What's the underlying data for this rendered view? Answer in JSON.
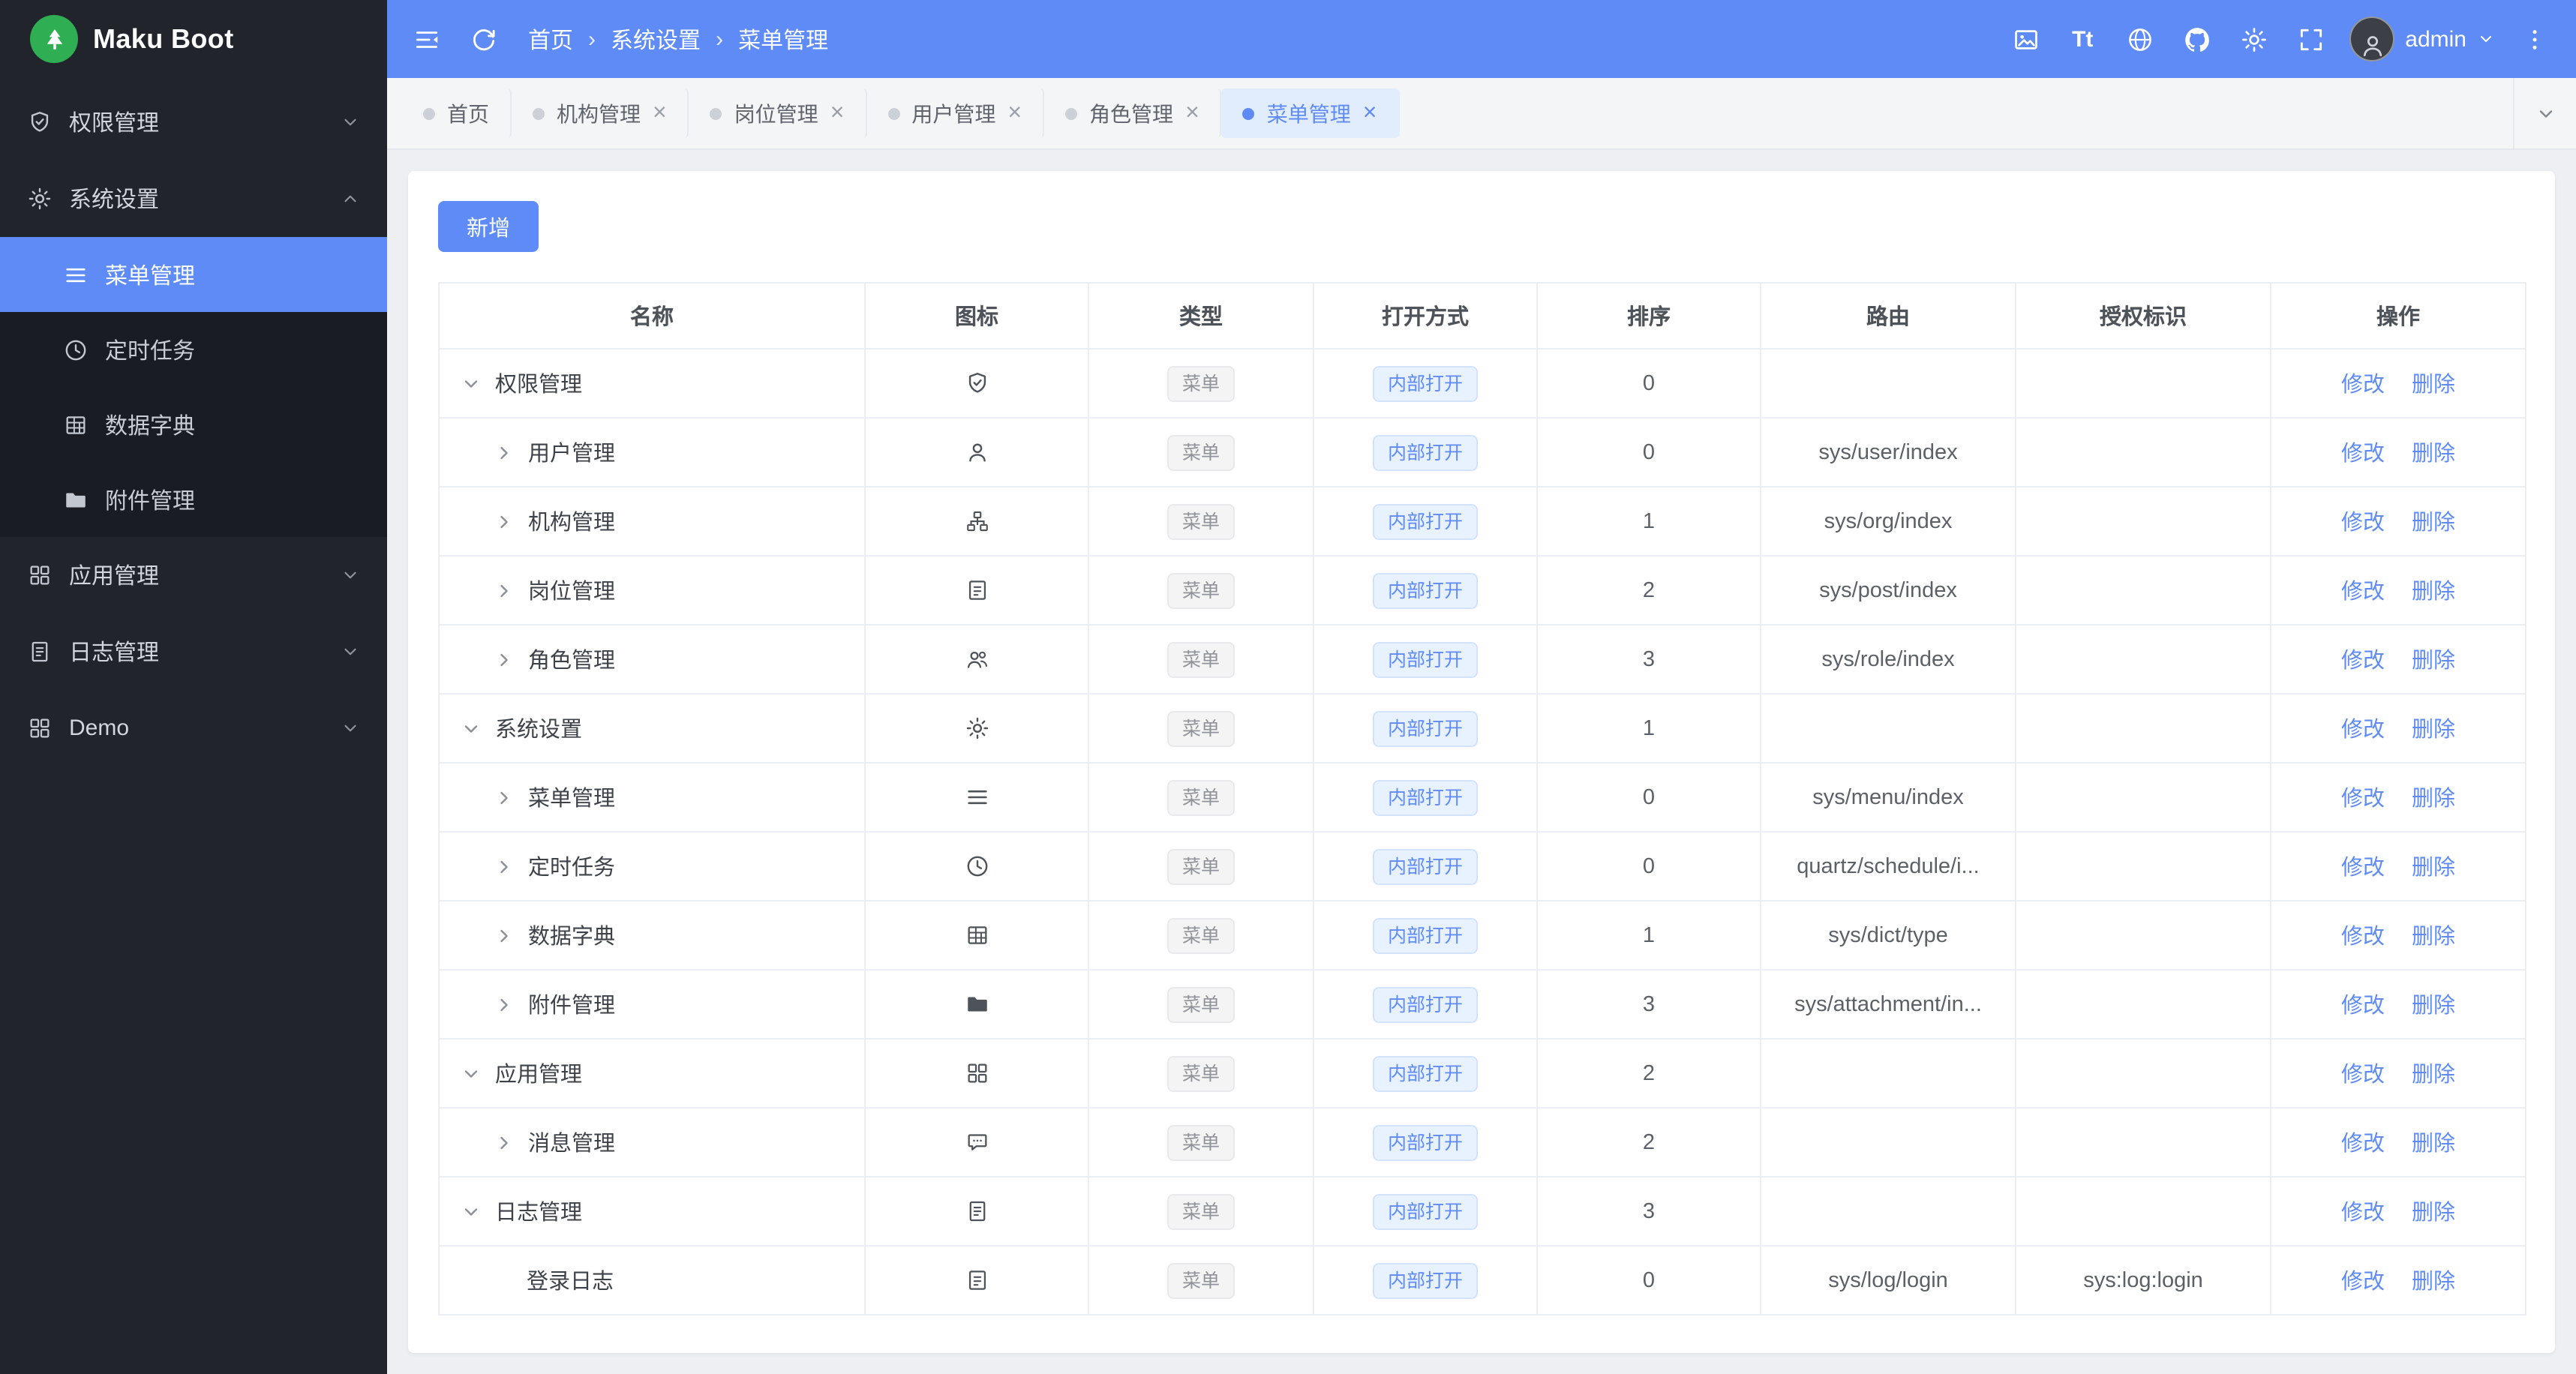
{
  "theme": {
    "primary": "#5e8bf5",
    "sidebar_bg": "#21242b",
    "submenu_bg": "#191c22",
    "logo_green": "#2fae53",
    "tag_gray_text": "#909399",
    "tag_blue_text": "#5e8bf5"
  },
  "logo": {
    "title": "Maku Boot"
  },
  "header": {
    "breadcrumb": [
      "首页",
      "系统设置",
      "菜单管理"
    ],
    "separator": "›",
    "tools": [
      {
        "key": "image",
        "icon": "image"
      },
      {
        "key": "font-size",
        "label": "Tt"
      },
      {
        "key": "language",
        "icon": "globe"
      },
      {
        "key": "github",
        "icon": "github"
      },
      {
        "key": "settings",
        "icon": "gear"
      },
      {
        "key": "fullscreen",
        "icon": "fullscreen"
      }
    ],
    "user": {
      "name": "admin"
    }
  },
  "sidebar": {
    "items": [
      {
        "key": "permission",
        "label": "权限管理",
        "icon": "shield",
        "expanded": false
      },
      {
        "key": "system",
        "label": "系统设置",
        "icon": "gear",
        "expanded": true,
        "children": [
          {
            "key": "menu",
            "label": "菜单管理",
            "icon": "menu",
            "active": true
          },
          {
            "key": "schedule",
            "label": "定时任务",
            "icon": "clock",
            "active": false
          },
          {
            "key": "dict",
            "label": "数据字典",
            "icon": "table",
            "active": false
          },
          {
            "key": "attachment",
            "label": "附件管理",
            "icon": "folder",
            "active": false
          }
        ]
      },
      {
        "key": "apps",
        "label": "应用管理",
        "icon": "grid",
        "expanded": false
      },
      {
        "key": "logs",
        "label": "日志管理",
        "icon": "doc",
        "expanded": false
      },
      {
        "key": "demo",
        "label": "Demo",
        "icon": "grid",
        "expanded": false
      }
    ]
  },
  "tabs": {
    "close_glyph": "×",
    "items": [
      {
        "key": "home",
        "label": "首页",
        "closable": false,
        "active": false
      },
      {
        "key": "org",
        "label": "机构管理",
        "closable": true,
        "active": false
      },
      {
        "key": "post",
        "label": "岗位管理",
        "closable": true,
        "active": false
      },
      {
        "key": "user",
        "label": "用户管理",
        "closable": true,
        "active": false
      },
      {
        "key": "role",
        "label": "角色管理",
        "closable": true,
        "active": false
      },
      {
        "key": "menu",
        "label": "菜单管理",
        "closable": true,
        "active": true
      }
    ]
  },
  "toolbar": {
    "add_label": "新增"
  },
  "table": {
    "headers": [
      "名称",
      "图标",
      "类型",
      "打开方式",
      "排序",
      "路由",
      "授权标识",
      "操作"
    ],
    "actions": [
      "修改",
      "删除"
    ],
    "rows": [
      {
        "name": "权限管理",
        "indent": 0,
        "arrow": "down",
        "icon": "shield",
        "type": "菜单",
        "open": "内部打开",
        "sort": "0",
        "route": "",
        "auth": ""
      },
      {
        "name": "用户管理",
        "indent": 1,
        "arrow": "right",
        "icon": "user",
        "type": "菜单",
        "open": "内部打开",
        "sort": "0",
        "route": "sys/user/index",
        "auth": ""
      },
      {
        "name": "机构管理",
        "indent": 1,
        "arrow": "right",
        "icon": "org",
        "type": "菜单",
        "open": "内部打开",
        "sort": "1",
        "route": "sys/org/index",
        "auth": ""
      },
      {
        "name": "岗位管理",
        "indent": 1,
        "arrow": "right",
        "icon": "badge",
        "type": "菜单",
        "open": "内部打开",
        "sort": "2",
        "route": "sys/post/index",
        "auth": ""
      },
      {
        "name": "角色管理",
        "indent": 1,
        "arrow": "right",
        "icon": "users",
        "type": "菜单",
        "open": "内部打开",
        "sort": "3",
        "route": "sys/role/index",
        "auth": ""
      },
      {
        "name": "系统设置",
        "indent": 0,
        "arrow": "down",
        "icon": "gear",
        "type": "菜单",
        "open": "内部打开",
        "sort": "1",
        "route": "",
        "auth": ""
      },
      {
        "name": "菜单管理",
        "indent": 1,
        "arrow": "right",
        "icon": "menu",
        "type": "菜单",
        "open": "内部打开",
        "sort": "0",
        "route": "sys/menu/index",
        "auth": ""
      },
      {
        "name": "定时任务",
        "indent": 1,
        "arrow": "right",
        "icon": "clock",
        "type": "菜单",
        "open": "内部打开",
        "sort": "0",
        "route": "quartz/schedule/i...",
        "auth": ""
      },
      {
        "name": "数据字典",
        "indent": 1,
        "arrow": "right",
        "icon": "table",
        "type": "菜单",
        "open": "内部打开",
        "sort": "1",
        "route": "sys/dict/type",
        "auth": ""
      },
      {
        "name": "附件管理",
        "indent": 1,
        "arrow": "right",
        "icon": "folder",
        "type": "菜单",
        "open": "内部打开",
        "sort": "3",
        "route": "sys/attachment/in...",
        "auth": ""
      },
      {
        "name": "应用管理",
        "indent": 0,
        "arrow": "down",
        "icon": "grid",
        "type": "菜单",
        "open": "内部打开",
        "sort": "2",
        "route": "",
        "auth": ""
      },
      {
        "name": "消息管理",
        "indent": 1,
        "arrow": "right",
        "icon": "message",
        "type": "菜单",
        "open": "内部打开",
        "sort": "2",
        "route": "",
        "auth": ""
      },
      {
        "name": "日志管理",
        "indent": 0,
        "arrow": "down",
        "icon": "doc",
        "type": "菜单",
        "open": "内部打开",
        "sort": "3",
        "route": "",
        "auth": ""
      },
      {
        "name": "登录日志",
        "indent": 2,
        "arrow": "none",
        "icon": "badge",
        "type": "菜单",
        "open": "内部打开",
        "sort": "0",
        "route": "sys/log/login",
        "auth": "sys:log:login"
      }
    ]
  }
}
